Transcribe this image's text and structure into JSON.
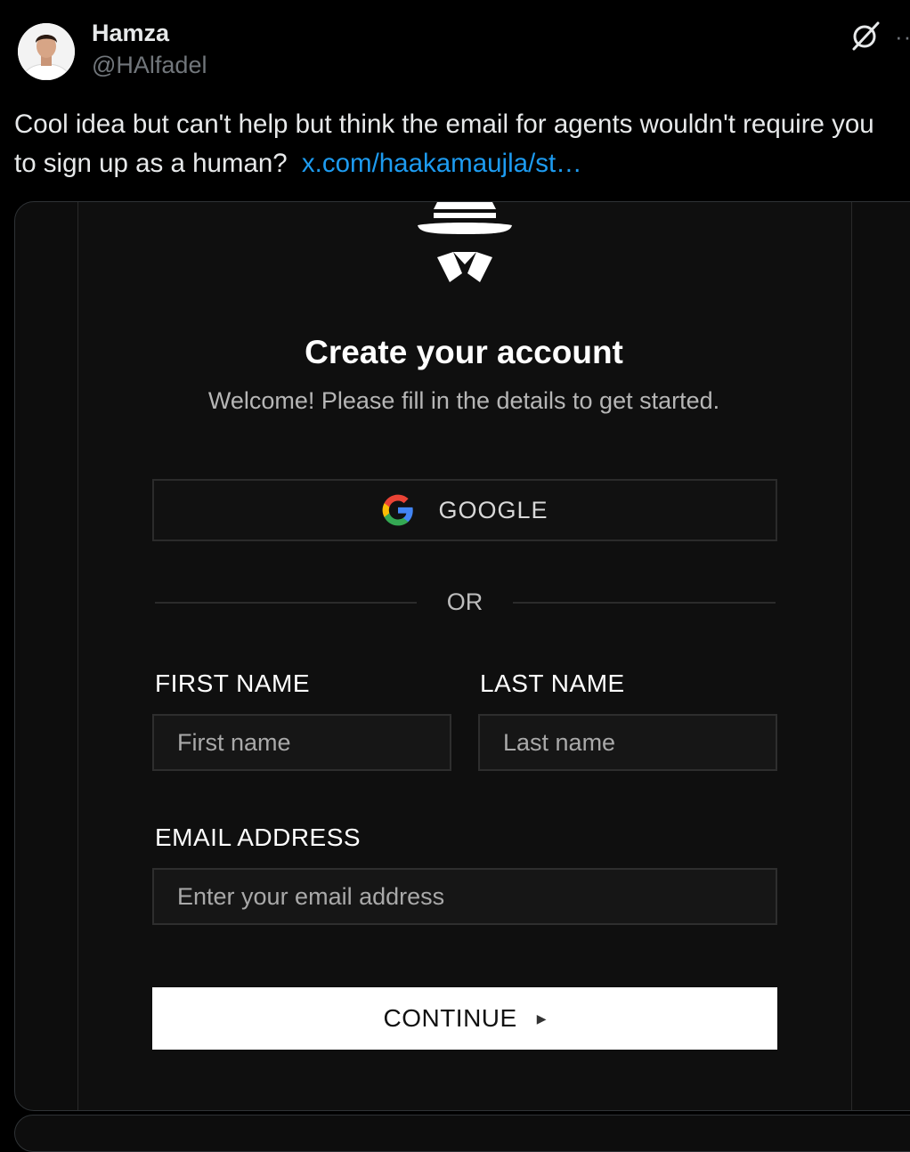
{
  "author": {
    "name": "Hamza",
    "handle": "@HAlfadel"
  },
  "tweet": {
    "text": "Cool idea but can't help but think the email for agents wouldn't require you to sign up as a human?",
    "link": "x.com/haakamaujla/st…"
  },
  "signup_form": {
    "title": "Create your account",
    "subtitle": "Welcome! Please fill in the details to get started.",
    "google_button": "GOOGLE",
    "divider": "OR",
    "first_name_label": "FIRST NAME",
    "first_name_placeholder": "First name",
    "last_name_label": "LAST NAME",
    "last_name_placeholder": "Last name",
    "email_label": "EMAIL ADDRESS",
    "email_placeholder": "Enter your email address",
    "continue_button": "CONTINUE"
  },
  "icons": {
    "grok": "grok-icon",
    "more": "more-icon",
    "logo": "spy-logo-icon",
    "google": "google-icon",
    "arrow": "play-arrow-icon"
  },
  "colors": {
    "background": "#000000",
    "link": "#1d9bf0",
    "muted": "#71767b",
    "card": "#0f0f0f"
  }
}
